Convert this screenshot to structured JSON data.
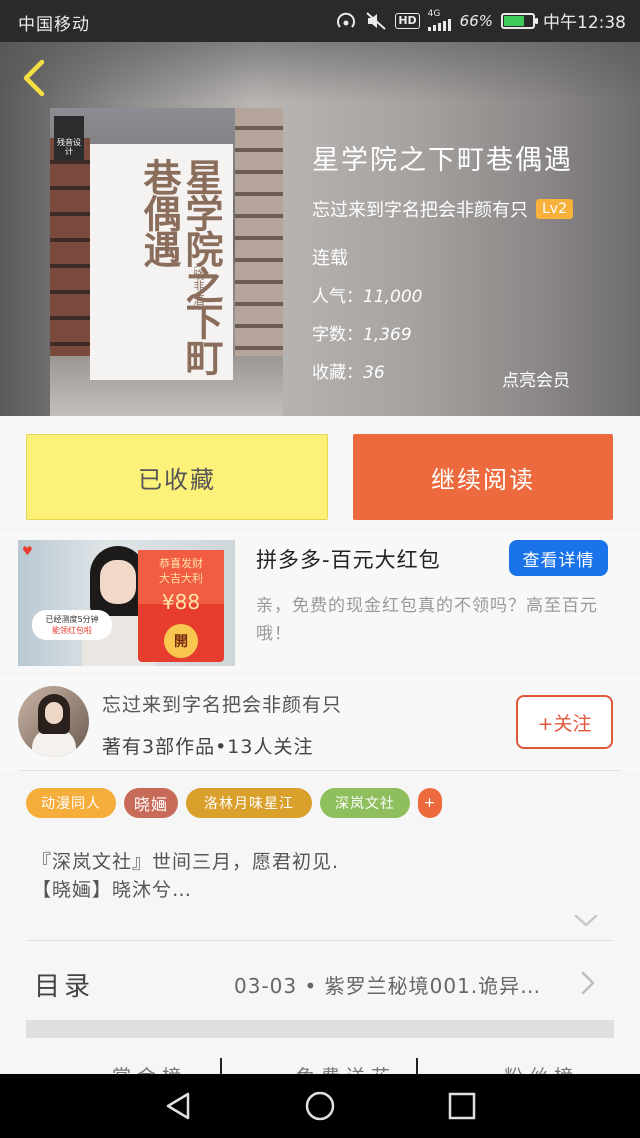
{
  "status_bar": {
    "carrier": "中国移动",
    "network": "4G",
    "hd": "HD",
    "battery_percent": "66%",
    "battery_level": 0.66,
    "time": "中午12:38"
  },
  "book": {
    "title": "星学院之下町巷偶遇",
    "author": "忘过来到字名把会非颜有只",
    "level": "Lv2",
    "status": "连载",
    "popularity_label": "人气：",
    "popularity_value": "11,000",
    "words_label": "字数：",
    "words_value": "1,369",
    "favorites_label": "收藏：",
    "favorites_value": "36",
    "vip_link": "点亮会员",
    "cover": {
      "title": "星学院之下町巷偶遇",
      "subtitle": "〈晓非·酒〉",
      "logo_text": "残音设计"
    }
  },
  "actions": {
    "collect_label": "已收藏",
    "read_label": "继续阅读"
  },
  "ad": {
    "title": "拼多多-百元大红包",
    "button_label": "查看详情",
    "description": "亲，免费的现金红包真的不领吗？高至百元哦！",
    "image": {
      "card_caption": "恭喜发财\n大吉大利",
      "amount": "¥88",
      "open_label": "開",
      "bubble_line1": "已经测度5分钟",
      "bubble_line2": "能领红包啦"
    }
  },
  "author_section": {
    "name": "忘过来到字名把会非颜有只",
    "stats": "著有3部作品•13人关注",
    "follow_label": "+关注"
  },
  "tags": [
    {
      "label": "动漫同人",
      "color": "#f5ad3b"
    },
    {
      "label": "晓婳",
      "color": "#c86a58"
    },
    {
      "label": "洛林月味星江",
      "color": "#d9a02c"
    },
    {
      "label": "深岚文社",
      "color": "#8fbf5c"
    },
    {
      "label": "+",
      "color": "#ec6a3d"
    }
  ],
  "intro": {
    "line1": "『深岚文社』世间三月，愿君初见.",
    "line2": "【晓婳】晓沐兮…"
  },
  "toc": {
    "label": "目录",
    "latest": "03-03 • 紫罗兰秘境001.诡异…"
  },
  "bottom_tabs": [
    "赏金榜",
    "免费送花",
    "粉丝榜"
  ],
  "colors": {
    "collect_button": "#fcf27a",
    "read_button": "#ec6a3d",
    "ad_button": "#1a73e8",
    "follow_button": "#e0583c",
    "level_badge": "#f8b13a"
  },
  "icons": {
    "back": "chevron-left-icon",
    "expand": "chevron-down-icon",
    "toc_arrow": "chevron-right-icon",
    "nav_back": "triangle-back-icon",
    "nav_home": "circle-home-icon",
    "nav_recent": "square-recent-icon"
  }
}
